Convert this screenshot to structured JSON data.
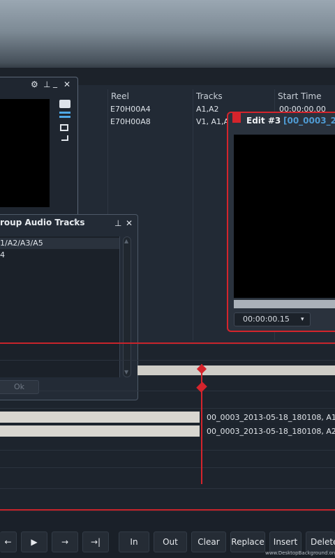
{
  "bin_table": {
    "columns": [
      "Reel",
      "Tracks",
      "Start Time"
    ],
    "rows": [
      {
        "reel": "E70H00A4",
        "tracks": "A1,A2",
        "start_time": "00:00:00.00"
      },
      {
        "reel": "E70H00A8",
        "tracks": "V1, A1,A",
        "start_time": ""
      }
    ]
  },
  "viewer_panel": {
    "icons": [
      "gear-icon",
      "pin-icon",
      "minimize-icon",
      "close-icon"
    ]
  },
  "audio_dialog": {
    "title": "roup Audio Tracks",
    "items": [
      "1/A2/A3/A5",
      "4"
    ],
    "ok_label": "Ok"
  },
  "edit_window": {
    "title": "Edit #3",
    "clip_name": "[00_0003_20",
    "timecode": "00:00:00.15",
    "accent_color": "#d5242c"
  },
  "timeline": {
    "clips": [
      "00_0003_2013-05-18_180108, A1",
      "00_0003_2013-05-18_180108, A2"
    ]
  },
  "transport": {
    "buttons": [
      "←",
      "▶",
      "→",
      "→|"
    ],
    "edit_buttons": [
      "In",
      "Out",
      "Clear",
      "Replace",
      "Insert",
      "Delete"
    ]
  },
  "watermark": "www.DesktopBackground.org"
}
